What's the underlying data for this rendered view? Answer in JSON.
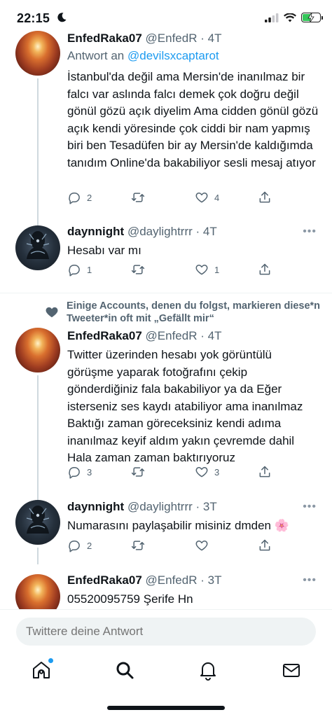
{
  "status_bar": {
    "time": "22:15",
    "icons": [
      "moon-icon",
      "cellular-signal-icon",
      "wifi-icon",
      "battery-charging-icon"
    ],
    "battery_color": "#34c759",
    "battery_level": 0.55
  },
  "tweets": [
    {
      "name": "EnfedRaka07",
      "handle": "@EnfedR",
      "time": "4T",
      "reply_prefix": "Antwort an",
      "reply_handle": "@devilsxcaptarot",
      "text": "İstanbul'da değil ama Mersin'de inanılmaz bir falcı var aslında falcı demek çok doğru değil gönül gözü açık diyelim Ama cidden gönül gözü açık kendi yöresinde çok ciddi bir nam yapmış biri ben Tesadüfen bir ay Mersin'de kaldığımda tanıdım Online'da bakabiliyor sesli mesaj atıyor",
      "replies": "2",
      "retweets": "",
      "likes": "4"
    },
    {
      "name": "daynnight",
      "handle": "@daylightrrr",
      "time": "4T",
      "text": "Hesabı var mı",
      "replies": "1",
      "retweets": "",
      "likes": "1"
    },
    {
      "social_context": "Einige Accounts, denen du folgst, markieren diese*n Tweeter*in oft mit „Gefällt mir“",
      "name": "EnfedRaka07",
      "handle": "@EnfedR",
      "time": "4T",
      "text": "Twitter üzerinden hesabı yok görüntülü görüşme yaparak fotoğrafını çekip gönderdiğiniz fala bakabiliyor ya da Eğer isterseniz ses kaydı atabiliyor ama inanılmaz Baktığı zaman göreceksiniz kendi adıma inanılmaz keyif aldım yakın çevremde dahil Hala zaman zaman baktırıyoruz",
      "replies": "3",
      "retweets": "",
      "likes": "3"
    },
    {
      "name": "daynnight",
      "handle": "@daylightrrr",
      "time": "3T",
      "text": "Numarasını paylaşabilir misiniz dmden",
      "emoji": "🌸",
      "replies": "2",
      "retweets": "",
      "likes": ""
    },
    {
      "name": "EnfedRaka07",
      "handle": "@EnfedR",
      "time": "3T",
      "text": "05520095759 Şerife Hn"
    }
  ],
  "more_glyph": "•••",
  "reply_bar": {
    "placeholder": "Twittere deine Antwort"
  },
  "bottom_nav": {
    "items": [
      "home-icon",
      "search-icon",
      "notifications-bell-icon",
      "messages-envelope-icon"
    ],
    "accent": "#1d9bf0"
  }
}
